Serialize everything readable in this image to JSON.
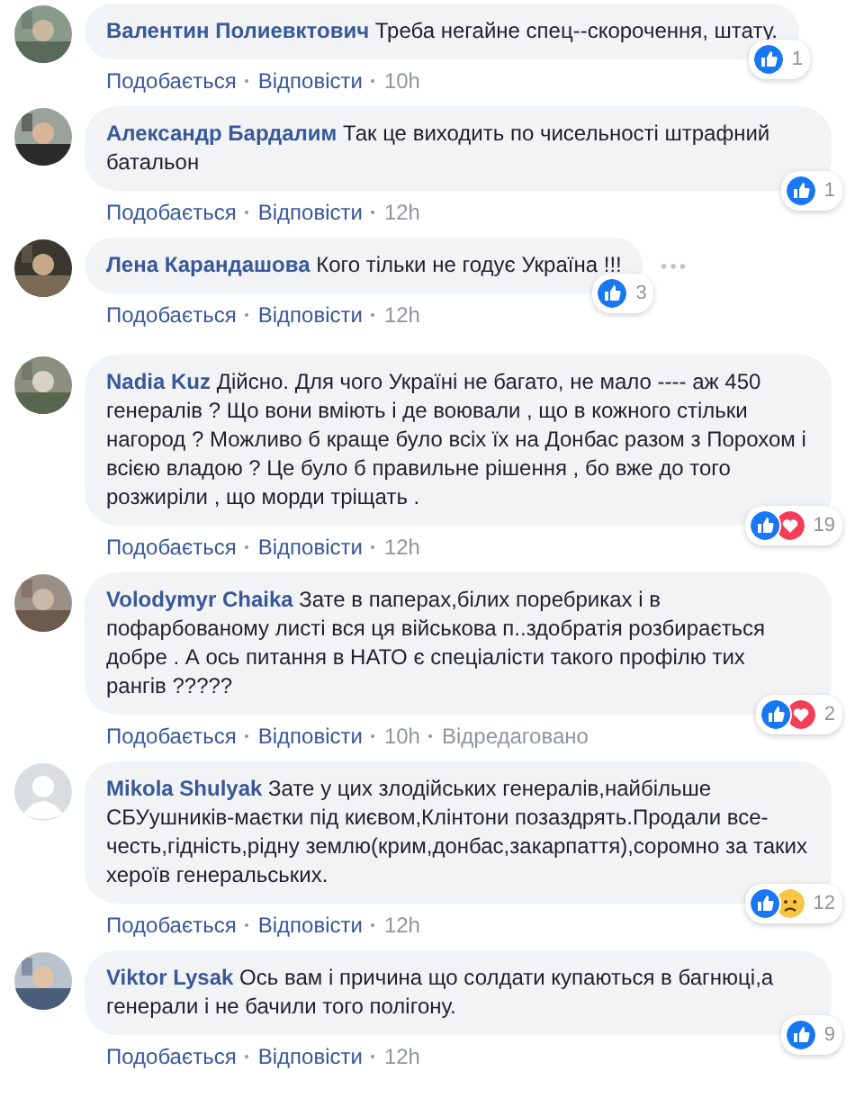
{
  "comments": [
    {
      "avatar": {
        "kind": "picture"
      },
      "author": "Валентин Полиевктович",
      "text": "Треба негайне спец--скорочення, штату.",
      "actions": [
        "Подобається",
        "Відповісти",
        "10h"
      ],
      "reactions": {
        "kinds": [
          {
            "kind": "like"
          }
        ],
        "count": "1"
      },
      "more": false
    },
    {
      "avatar": {
        "kind": "picture"
      },
      "author": "Александр Бардалим",
      "text": "Так це виходить по чисельності штрафний батальон",
      "actions": [
        "Подобається",
        "Відповісти",
        "12h"
      ],
      "reactions": {
        "kinds": [
          {
            "kind": "like"
          }
        ],
        "count": "1"
      },
      "more": false
    },
    {
      "avatar": {
        "kind": "picture"
      },
      "author": "Лена Карандашова",
      "text": "Кого тільки не годує Україна !!!",
      "actions": [
        "Подобається",
        "Відповісти",
        "12h"
      ],
      "reactions": {
        "kinds": [
          {
            "kind": "like"
          }
        ],
        "count": "3"
      },
      "more": true
    },
    {
      "avatar": {
        "kind": "picture"
      },
      "author": "Nadia Kuz",
      "text": "Дійсно. Для чого Україні не багато, не мало ---- аж 450 генералів ? Що вони вміють і де воювали , що в кожного стільки нагород ? Можливо б краще було всіх їх на Донбас разом з Порохом і всією владою ? Це було б правильне рішення , бо вже до того розжиріли , що морди тріщать .",
      "actions": [
        "Подобається",
        "Відповісти",
        "12h"
      ],
      "reactions": {
        "kinds": [
          {
            "kind": "like"
          },
          {
            "kind": "love"
          }
        ],
        "count": "19"
      },
      "more": false
    },
    {
      "avatar": {
        "kind": "picture"
      },
      "author": "Volodymyr Chaika",
      "text": "Зате в паперах,білих поребриках і в пофарбованому листі вся ця військова п..здобратія розбирається добре . А ось питання в НАТО є спеціалісти такого профілю тих рангів ?????",
      "actions": [
        "Подобається",
        "Відповісти",
        "10h",
        "Відредаговано"
      ],
      "reactions": {
        "kinds": [
          {
            "kind": "like"
          },
          {
            "kind": "love"
          }
        ],
        "count": "2"
      },
      "more": false
    },
    {
      "avatar": {
        "kind": "default"
      },
      "author": "Mikola Shulyak",
      "text": "Зате у цих злодійських генералів,найбільше СБУушників-маєтки під києвом,Клінтони позаздрять.Продали все-честь,гідність,рідну землю(крим,донбас,закарпаття),соромно за таких хероїв генеральських.",
      "actions": [
        "Подобається",
        "Відповісти",
        "12h"
      ],
      "reactions": {
        "kinds": [
          {
            "kind": "like"
          },
          {
            "kind": "sad"
          }
        ],
        "count": "12"
      },
      "more": false
    },
    {
      "avatar": {
        "kind": "picture"
      },
      "author": "Viktor Lysak",
      "text": "Ось вам і причина що солдати купаються в багнюці,а генерали і не бачили того полігону.",
      "actions": [
        "Подобається",
        "Відповісти",
        "12h"
      ],
      "reactions": {
        "kinds": [
          {
            "kind": "like"
          }
        ],
        "count": "9"
      },
      "more": false
    }
  ]
}
